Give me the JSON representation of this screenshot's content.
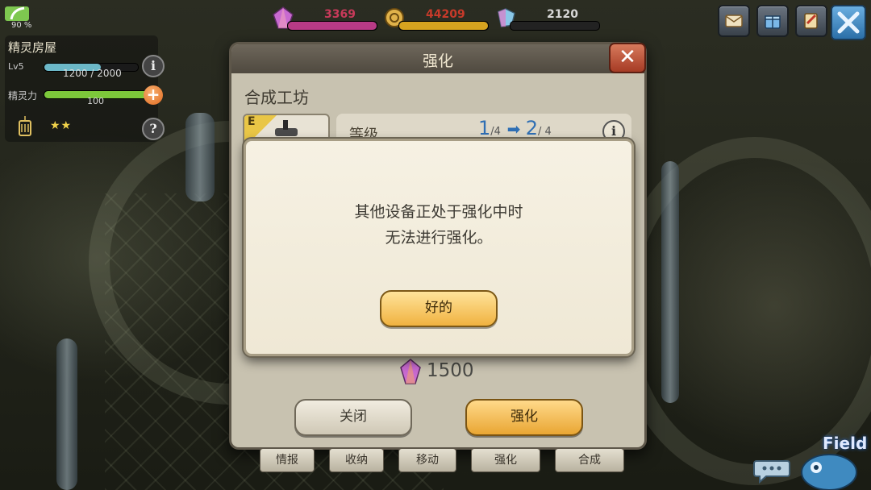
{
  "hud": {
    "battery_percent": "90 %",
    "house_title": "精灵房屋",
    "level_label": "Lv5",
    "exp_current": "1200",
    "exp_sep": "/",
    "exp_max": "2000",
    "exp_progress": 0.6,
    "spirit_label": "精灵力",
    "spirit_value": "100",
    "spirit_progress": 1.0,
    "stars": "★★"
  },
  "resources": [
    {
      "name": "gem-purple",
      "value": "3369",
      "color": "#b83a86",
      "progress": 1.0
    },
    {
      "name": "coin-gold",
      "value": "44209",
      "color": "#d6a31f",
      "progress": 1.0
    },
    {
      "name": "crystal",
      "value": "2120",
      "color": "#9aa0a8",
      "progress": 0.0
    }
  ],
  "panel": {
    "title": "强化",
    "subtitle": "合成工坊",
    "item_grade": "E",
    "level_label": "等级",
    "level_from": "1",
    "level_from_max": "/4",
    "level_to": "2",
    "level_to_max": "/ 4",
    "cost": "1500",
    "close_label": "关闭",
    "upgrade_label": "强化"
  },
  "tabs": [
    {
      "label": "情报"
    },
    {
      "label": "收纳"
    },
    {
      "label": "移动"
    },
    {
      "label": "强化"
    },
    {
      "label": "合成"
    }
  ],
  "dialog": {
    "line1": "其他设备正处于强化中时",
    "line2": "无法进行强化。",
    "ok_label": "好的"
  },
  "field": {
    "label": "Field"
  },
  "colors": {
    "accent_gold": "#f0b240",
    "panel_bg": "#c8c2b0",
    "level_blue": "#2f6fb4"
  }
}
